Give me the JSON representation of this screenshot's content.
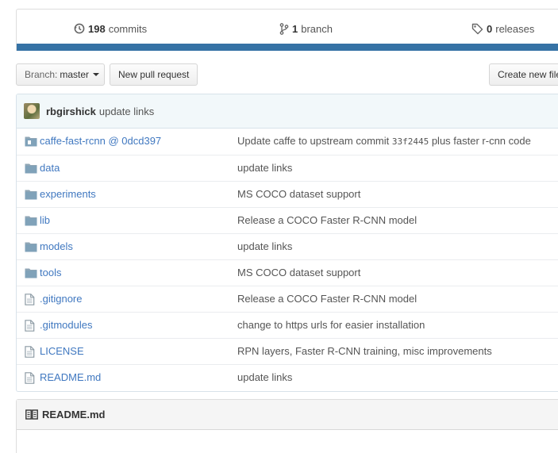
{
  "summary": {
    "commits": {
      "count": "198",
      "label": "commits",
      "icon": "history-icon"
    },
    "branches": {
      "count": "1",
      "label": "branch",
      "icon": "git-branch-icon"
    },
    "releases": {
      "count": "0",
      "label": "releases",
      "icon": "tag-icon"
    },
    "language_color": "#3572a5"
  },
  "toolbar": {
    "branch_prefix": "Branch:",
    "branch_name": "master",
    "new_pr_label": "New pull request",
    "create_file_label": "Create new file"
  },
  "latest_commit": {
    "author": "rbgirshick",
    "message": "update links"
  },
  "files": [
    {
      "name": "caffe-fast-rcnn @ 0dcd397",
      "type": "submodule",
      "icon": "submodule-icon",
      "msg_before": "Update caffe to upstream commit ",
      "msg_sha": "33f2445",
      "msg_after": " plus faster r-cnn code"
    },
    {
      "name": "data",
      "type": "dir",
      "icon": "folder-icon",
      "message": "update links"
    },
    {
      "name": "experiments",
      "type": "dir",
      "icon": "folder-icon",
      "message": "MS COCO dataset support"
    },
    {
      "name": "lib",
      "type": "dir",
      "icon": "folder-icon",
      "message": "Release a COCO Faster R-CNN model"
    },
    {
      "name": "models",
      "type": "dir",
      "icon": "folder-icon",
      "message": "update links"
    },
    {
      "name": "tools",
      "type": "dir",
      "icon": "folder-icon",
      "message": "MS COCO dataset support"
    },
    {
      "name": ".gitignore",
      "type": "file",
      "icon": "file-icon",
      "message": "Release a COCO Faster R-CNN model"
    },
    {
      "name": ".gitmodules",
      "type": "file",
      "icon": "file-icon",
      "message": "change to https urls for easier installation"
    },
    {
      "name": "LICENSE",
      "type": "file",
      "icon": "file-icon",
      "message": "RPN layers, Faster R-CNN training, misc improvements"
    },
    {
      "name": "README.md",
      "type": "file",
      "icon": "file-icon",
      "message": "update links"
    }
  ],
  "readme": {
    "title": "README.md",
    "icon": "book-icon"
  }
}
